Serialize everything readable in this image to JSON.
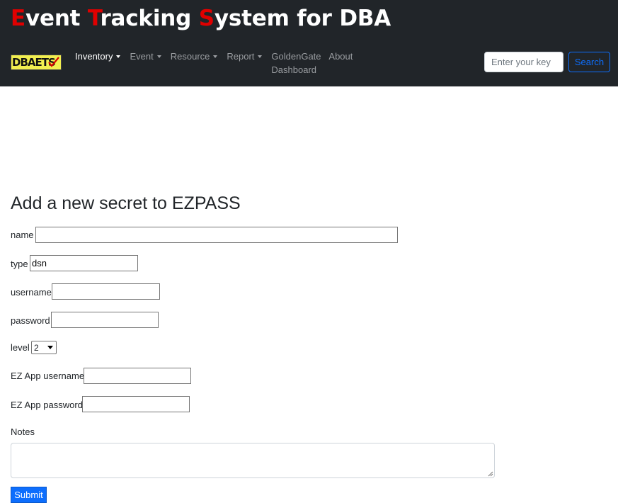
{
  "header": {
    "title_parts": [
      {
        "cap": "E",
        "rest": "vent "
      },
      {
        "cap": "T",
        "rest": "racking "
      },
      {
        "cap": "S",
        "rest": "ystem for DBA"
      }
    ],
    "logo_text": "DBAETS",
    "nav": {
      "inventory": "Inventory",
      "event": "Event",
      "resource": "Resource",
      "report": "Report",
      "goldengate": "GoldenGate Dashboard",
      "about": "About"
    },
    "search_placeholder": "Enter your key",
    "search_button": "Search"
  },
  "form": {
    "title": "Add a new secret to EZPASS",
    "name_label": "name",
    "name_value": "",
    "type_label": "type",
    "type_value": "dsn",
    "username_label": "username",
    "username_value": "",
    "password_label": "password",
    "password_value": "",
    "level_label": "level",
    "level_value": "2",
    "ez_username_label": "EZ App username",
    "ez_username_value": "",
    "ez_password_label": "EZ App password",
    "ez_password_value": "",
    "notes_label": "Notes",
    "submit_label": "Submit"
  },
  "colors": {
    "header_bg": "#212529",
    "title_accent": "#e00000",
    "primary": "#0d6efd"
  }
}
